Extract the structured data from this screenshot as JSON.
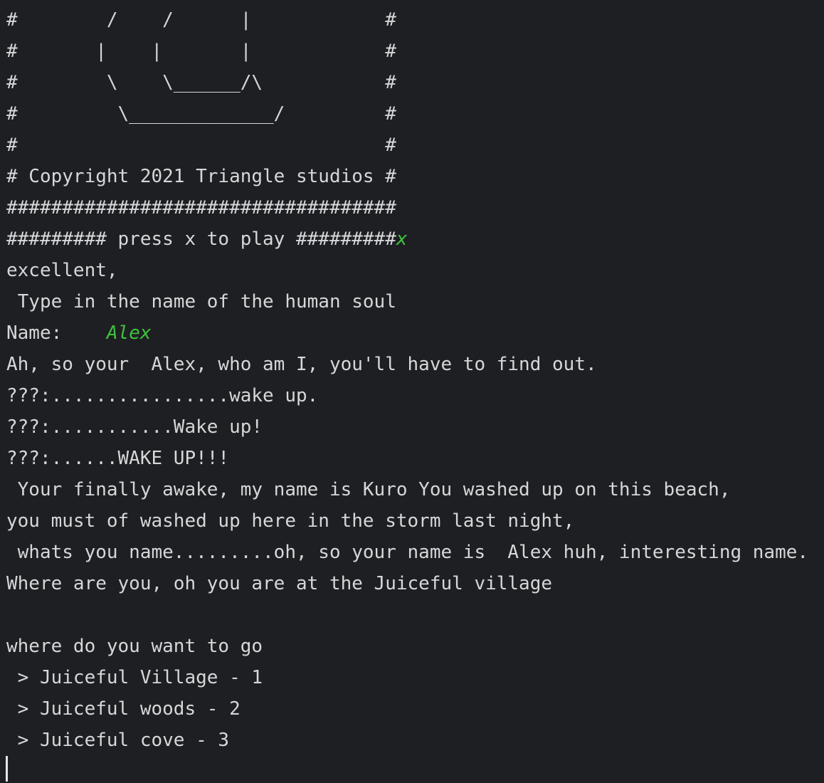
{
  "terminal": {
    "art_lines": [
      "#        /    /      |            #",
      "#       |    |       |            #",
      "#        \\    \\______/\\           #",
      "#         \\_____________/         #",
      "#                                 #",
      "# Copyright 2021 Triangle studios #",
      "###################################"
    ],
    "press_prompt": "######### press x to play #########",
    "press_input": "x",
    "excellent": "excellent,",
    "type_name": " Type in the name of the human soul",
    "name_label": "Name:    ",
    "name_input": "Alex",
    "ah_line": "Ah, so your  Alex, who am I, you'll have to find out.",
    "wake1": "???:................wake up.",
    "wake2": "???:...........Wake up!",
    "wake3": "???:......WAKE UP!!!",
    "story1": " Your finally awake, my name is Kuro You washed up on this beach,",
    "story2": "you must of washed up here in the storm last night,",
    "story3": " whats you name.........oh, so your name is  Alex huh, interesting name.",
    "story4": "Where are you, oh you are at the Juiceful village",
    "blank": "",
    "where_prompt": "where do you want to go",
    "options": [
      " > Juiceful Village - 1",
      " > Juiceful woods - 2",
      " > Juiceful cove - 3"
    ]
  },
  "colors": {
    "background": "#1e1f22",
    "text": "#d6d7d9",
    "input_echo": "#3ec23e"
  }
}
